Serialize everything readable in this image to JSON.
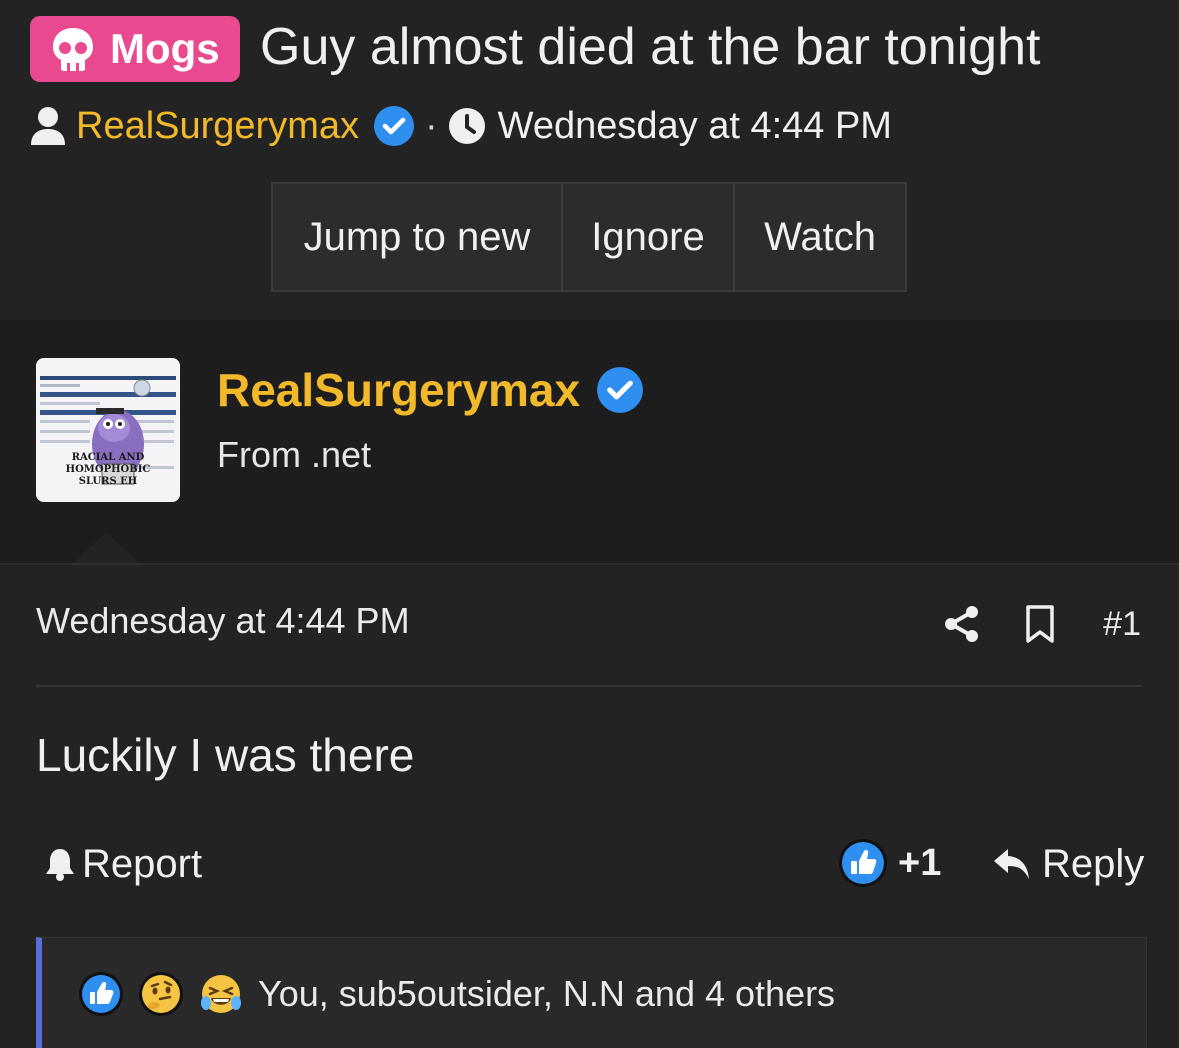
{
  "thread": {
    "prefix": "Mogs",
    "title": "Guy almost died at the bar tonight",
    "author": "RealSurgerymax",
    "date": "Wednesday at 4:44 PM"
  },
  "thread_actions": {
    "jump_label": "Jump to new",
    "ignore_label": "Ignore",
    "watch_label": "Watch"
  },
  "post": {
    "username": "RealSurgerymax",
    "user_title": "From .net",
    "avatar_text": [
      "RACIAL AND HOMOPHOBIC",
      "SLURS EH"
    ],
    "date": "Wednesday at 4:44 PM",
    "number": "#1",
    "body": "Luckily I was there",
    "report_label": "Report",
    "like_count": "+1",
    "reply_label": "Reply",
    "reactions_text": "You, sub5outsider, N.N and 4 others"
  },
  "colors": {
    "prefix_bg": "#e8498f",
    "username": "#f2b92b",
    "verified": "#2f8ff0",
    "reactions_accent": "#5b6dd6",
    "background": "#232323"
  },
  "icons": [
    "skull-icon",
    "user-icon",
    "verified-icon",
    "clock-icon",
    "share-icon",
    "bookmark-icon",
    "bell-icon",
    "like-icon",
    "reply-icon",
    "thinking-emoji",
    "laughing-emoji"
  ]
}
